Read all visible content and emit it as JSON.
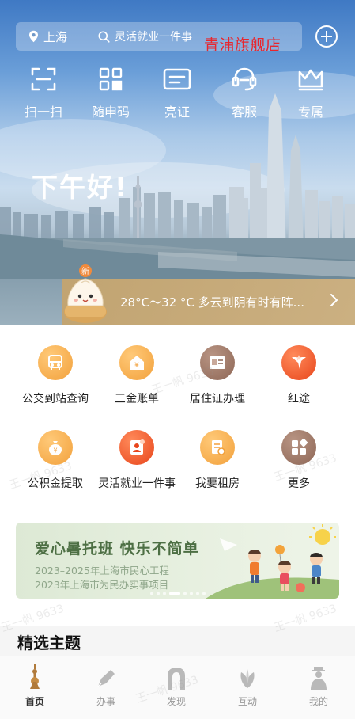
{
  "header": {
    "location": "上海",
    "search_hint": "灵活就业一件事",
    "brand_overlay": "青浦旗舰店"
  },
  "quick_actions": [
    {
      "label": "扫一扫",
      "icon": "scan-icon"
    },
    {
      "label": "随申码",
      "icon": "qr-code-icon"
    },
    {
      "label": "亮证",
      "icon": "id-card-icon"
    },
    {
      "label": "客服",
      "icon": "customer-service-icon"
    },
    {
      "label": "专属",
      "icon": "crown-icon"
    }
  ],
  "greeting": "下午好!",
  "weather": {
    "badge": "新",
    "text": "28°C～32 °C 多云到阴有时有阵..."
  },
  "services": [
    {
      "label": "公交到站查询",
      "icon": "bus-icon",
      "color": "#f2a13c"
    },
    {
      "label": "三金账单",
      "icon": "house-yen-icon",
      "color": "#f2a13c"
    },
    {
      "label": "居住证办理",
      "icon": "residence-card-icon",
      "color": "#9a7462"
    },
    {
      "label": "红途",
      "icon": "star-flag-icon",
      "color": "#ee5b2b"
    },
    {
      "label": "公积金提取",
      "icon": "money-bag-icon",
      "color": "#f2a13c"
    },
    {
      "label": "灵活就业一件事",
      "icon": "employment-icon",
      "color": "#ee5b2b"
    },
    {
      "label": "我要租房",
      "icon": "rent-document-icon",
      "color": "#f2a13c"
    },
    {
      "label": "更多",
      "icon": "more-grid-icon",
      "color": "#9a7462"
    }
  ],
  "banner": {
    "title": "爱心暑托班 快乐不简单",
    "line1": "2023–2025年上海市民心工程",
    "line2": "2023年上海市为民办实事项目"
  },
  "section": {
    "title": "精选主题"
  },
  "tabs": [
    {
      "label": "首页",
      "icon": "home-tower-icon",
      "active": true
    },
    {
      "label": "办事",
      "icon": "pen-icon",
      "active": false
    },
    {
      "label": "发现",
      "icon": "arch-gate-icon",
      "active": false
    },
    {
      "label": "互动",
      "icon": "magnolia-icon",
      "active": false
    },
    {
      "label": "我的",
      "icon": "profile-figure-icon",
      "active": false
    }
  ],
  "watermark": "王一帆 9633",
  "colors": {
    "accent_orange": "#f2a13c",
    "accent_red": "#ee5b2b",
    "accent_brown": "#9a7462",
    "weather_gold": "#c9a66b"
  }
}
